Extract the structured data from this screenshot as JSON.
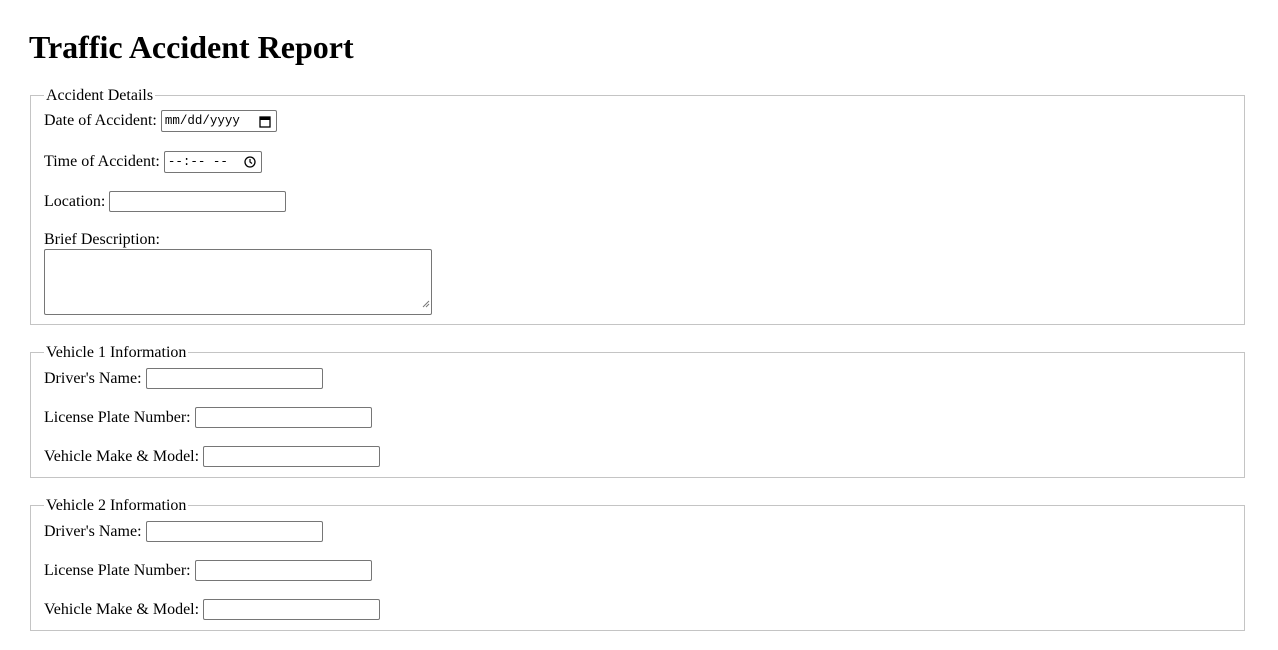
{
  "page": {
    "title": "Traffic Accident Report"
  },
  "accident": {
    "legend": "Accident Details",
    "date_label": "Date of Accident:",
    "date_placeholder": "mm/dd/yyyy",
    "time_label": "Time of Accident:",
    "time_placeholder": "--:-- --",
    "location_label": "Location:",
    "location_value": "",
    "description_label": "Brief Description:",
    "description_value": ""
  },
  "vehicle1": {
    "legend": "Vehicle 1 Information",
    "driver_label": "Driver's Name:",
    "driver_value": "",
    "plate_label": "License Plate Number:",
    "plate_value": "",
    "model_label": "Vehicle Make & Model:",
    "model_value": ""
  },
  "vehicle2": {
    "legend": "Vehicle 2 Information",
    "driver_label": "Driver's Name:",
    "driver_value": "",
    "plate_label": "License Plate Number:",
    "plate_value": "",
    "model_label": "Vehicle Make & Model:",
    "model_value": ""
  },
  "icons": {
    "date": "calendar-icon",
    "time": "clock-icon",
    "resize": "resize-grip-icon"
  }
}
